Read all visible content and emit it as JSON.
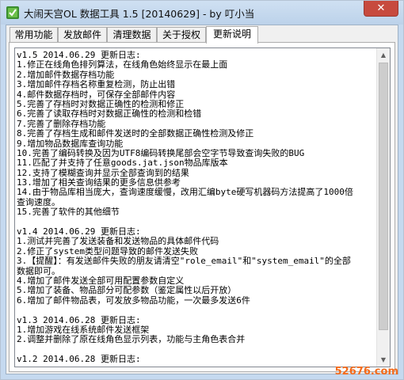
{
  "window": {
    "title": "大闹天宫OL 数据工具 1.5 [20140629] - by 叮小当",
    "close_glyph": "✕"
  },
  "tabs": [
    {
      "label": "常用功能",
      "active": false
    },
    {
      "label": "发放邮件",
      "active": false
    },
    {
      "label": "清理数据",
      "active": false
    },
    {
      "label": "关于授权",
      "active": false
    },
    {
      "label": "更新说明",
      "active": true
    }
  ],
  "changelog": [
    "v1.5 2014.06.29 更新日志:",
    "1.修正在线角色排列算法，在线角色始终显示在最上面",
    "2.增加邮件数据存档功能",
    "3.增加邮件存档名称重复检测，防止出错",
    "4.邮件数据存档时，可保存全部邮件内容",
    "5.完善了存档时对数据正确性的检测和修正",
    "6.完善了读取存档时对数据正确性的检测和检错",
    "7.完善了删除存档功能",
    "8.完善了存档生成和邮件发送时的全部数据正确性检测及修正",
    "9.增加物品数据库查询功能",
    "10.完善了编码转换及因为UTF8编码转换尾部会空字节导致查询失败的BUG",
    "11.匹配了并支持了任意goods.jat.json物品库版本",
    "12.支持了模糊查询并显示全部查询到的结果",
    "13.增加了相关查询结果的更多信息供参考",
    "14.由于物品库相当庞大，查询速度缓慢，改用汇编byte硬写机器码方法提高了1000倍",
    "查询速度。",
    "15.完善了软件的其他细节",
    "",
    "v1.4 2014.06.29 更新日志:",
    "1.测试并完善了发送装备和发送物品的具体邮件代码",
    "2.修正了system类型问题导致的邮件发送失败",
    "3.【提醒】：有发送邮件失败的朋友请清空\"role_email\"和\"system_email\"的全部",
    "数据即可。",
    "4.增加了邮件发送全部可用配置参数自定义",
    "5.增加了装备、物品部分可配参数（鉴定属性以后开放）",
    "6.增加了邮件物品表，可发放多物品功能，一次最多发送6件",
    "",
    "v1.3 2014.06.28 更新日志:",
    "1.增加游戏在线系统邮件发送框架",
    "2.调整并删除了原在线角色显示列表，功能与主角色表合并",
    "",
    "v1.2 2014.06.28 更新日志:"
  ],
  "watermark": "52676.com",
  "colors": {
    "frame": "#c5d9ef",
    "close_button": "#c74a3e",
    "watermark": "#f36b1c"
  }
}
